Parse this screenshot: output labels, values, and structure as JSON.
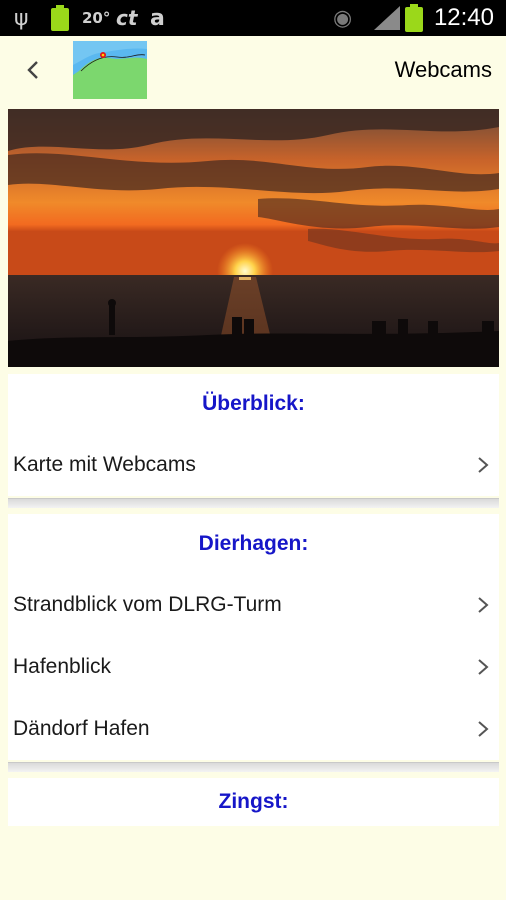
{
  "status_bar": {
    "temperature": "20°",
    "ct_label": "ct",
    "amazon_label": "a",
    "time": "12:40"
  },
  "action_bar": {
    "title": "Webcams"
  },
  "sections": [
    {
      "header": "Überblick:",
      "items": [
        {
          "label": "Karte mit Webcams"
        }
      ]
    },
    {
      "header": "Dierhagen:",
      "items": [
        {
          "label": "Strandblick vom DLRG-Turm"
        },
        {
          "label": "Hafenblick"
        },
        {
          "label": "Dändorf Hafen"
        }
      ]
    },
    {
      "header": "Zingst:",
      "items": []
    }
  ],
  "colors": {
    "background": "#fdfde6",
    "section_header": "#1616c8"
  }
}
